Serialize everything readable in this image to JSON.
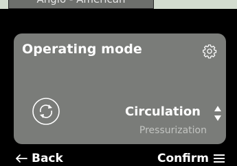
{
  "header": {
    "tab_label": "Anglo - American"
  },
  "card": {
    "title": "Operating mode",
    "mode_selected": "Circulation",
    "mode_next": "Pressurization"
  },
  "footer": {
    "back_label": "Back",
    "confirm_label": "Confirm"
  },
  "colors": {
    "background": "#d3dccf",
    "panel": "#000000",
    "card": "#7a7c79",
    "text_primary": "#ffffff",
    "text_secondary": "#c2c4c1"
  },
  "icons": [
    "gear-icon",
    "cycle-icon",
    "up-down-arrows-icon",
    "back-arrow-icon",
    "menu-icon"
  ]
}
